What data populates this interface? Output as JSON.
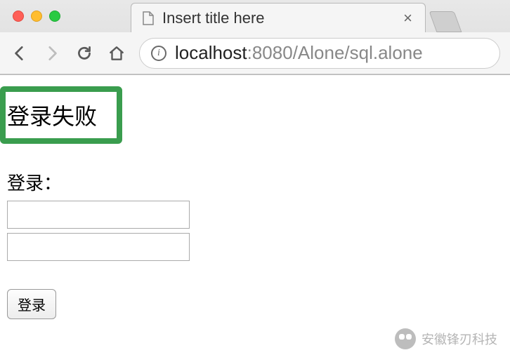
{
  "browser": {
    "tab": {
      "title": "Insert title here"
    },
    "address": {
      "host": "localhost",
      "port_path": ":8080/Alone/sql.alone"
    }
  },
  "page": {
    "error_banner": "登录失败",
    "login_heading": "登录：",
    "input1_value": "",
    "input2_value": "",
    "login_button": "登录"
  },
  "watermark": {
    "text": "安徽锋刃科技"
  }
}
